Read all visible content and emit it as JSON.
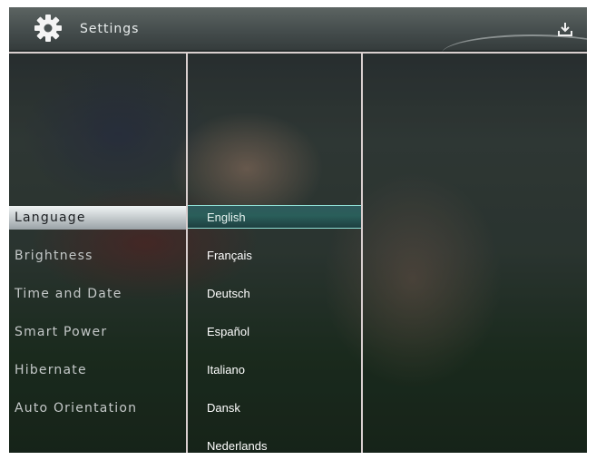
{
  "header": {
    "title": "Settings",
    "icon": "gear-icon",
    "export_icon": "download-icon"
  },
  "menu": {
    "items": [
      {
        "label": "Language",
        "selected": true
      },
      {
        "label": "Brightness",
        "selected": false
      },
      {
        "label": "Time and Date",
        "selected": false
      },
      {
        "label": "Smart Power",
        "selected": false
      },
      {
        "label": "Hibernate",
        "selected": false
      },
      {
        "label": "Auto Orientation",
        "selected": false
      }
    ]
  },
  "languages": {
    "items": [
      {
        "label": "English",
        "selected": true
      },
      {
        "label": "Français",
        "selected": false
      },
      {
        "label": "Deutsch",
        "selected": false
      },
      {
        "label": "Español",
        "selected": false
      },
      {
        "label": "Italiano",
        "selected": false
      },
      {
        "label": "Dansk",
        "selected": false
      },
      {
        "label": "Nederlands",
        "selected": false
      }
    ]
  },
  "colors": {
    "accent": "#2a5e5a",
    "selection_border": "#8fe0d6",
    "divider": "#d9cfcf"
  }
}
